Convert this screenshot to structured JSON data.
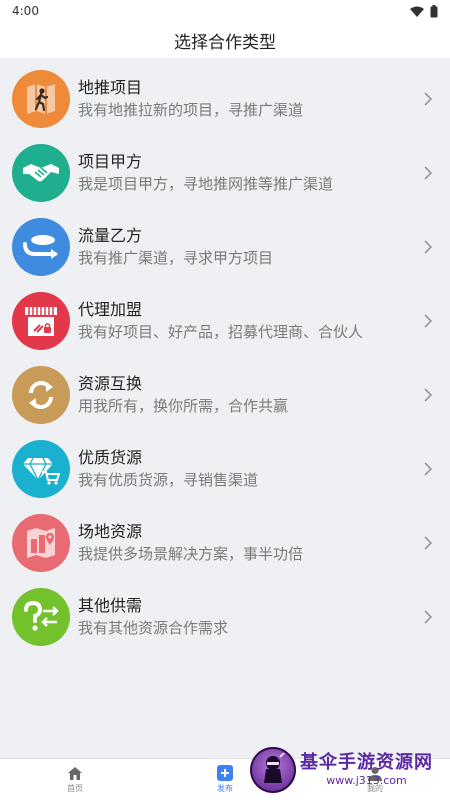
{
  "status_bar": {
    "time": "4:00",
    "wifi_icon": "wifi-icon",
    "battery_icon": "battery-icon"
  },
  "header": {
    "title": "选择合作类型"
  },
  "items": [
    {
      "title": "地推项目",
      "desc": "我有地推拉新的项目，寻推广渠道",
      "color": "#ef8a3a",
      "icon": "walking-map-icon"
    },
    {
      "title": "项目甲方",
      "desc": "我是项目甲方，寻地推网推等推广渠道",
      "color": "#1fae8e",
      "icon": "handshake-icon"
    },
    {
      "title": "流量乙方",
      "desc": "我有推广渠道，寻求甲方项目",
      "color": "#3f8be0",
      "icon": "traffic-icon"
    },
    {
      "title": "代理加盟",
      "desc": "我有好项目、好产品，招募代理商、合伙人",
      "color": "#e2384a",
      "icon": "store-icon"
    },
    {
      "title": "资源互换",
      "desc": "用我所有，换你所需，合作共赢",
      "color": "#c89b58",
      "icon": "exchange-icon"
    },
    {
      "title": "优质货源",
      "desc": "我有优质货源，寻销售渠道",
      "color": "#1ab0cf",
      "icon": "diamond-cart-icon"
    },
    {
      "title": "场地资源",
      "desc": "我提供多场景解决方案，事半功倍",
      "color": "#e86b73",
      "icon": "venue-map-icon"
    },
    {
      "title": "其他供需",
      "desc": "我有其他资源合作需求",
      "color": "#73c22c",
      "icon": "question-exchange-icon"
    }
  ],
  "tabbar": {
    "home": {
      "label": "首页",
      "icon": "home-icon"
    },
    "publish": {
      "label": "发布",
      "icon": "plus-icon"
    },
    "mine": {
      "label": "我的",
      "icon": "user-icon"
    }
  },
  "watermark": {
    "title": "基伞手游资源网",
    "url": "www.j313.com"
  }
}
